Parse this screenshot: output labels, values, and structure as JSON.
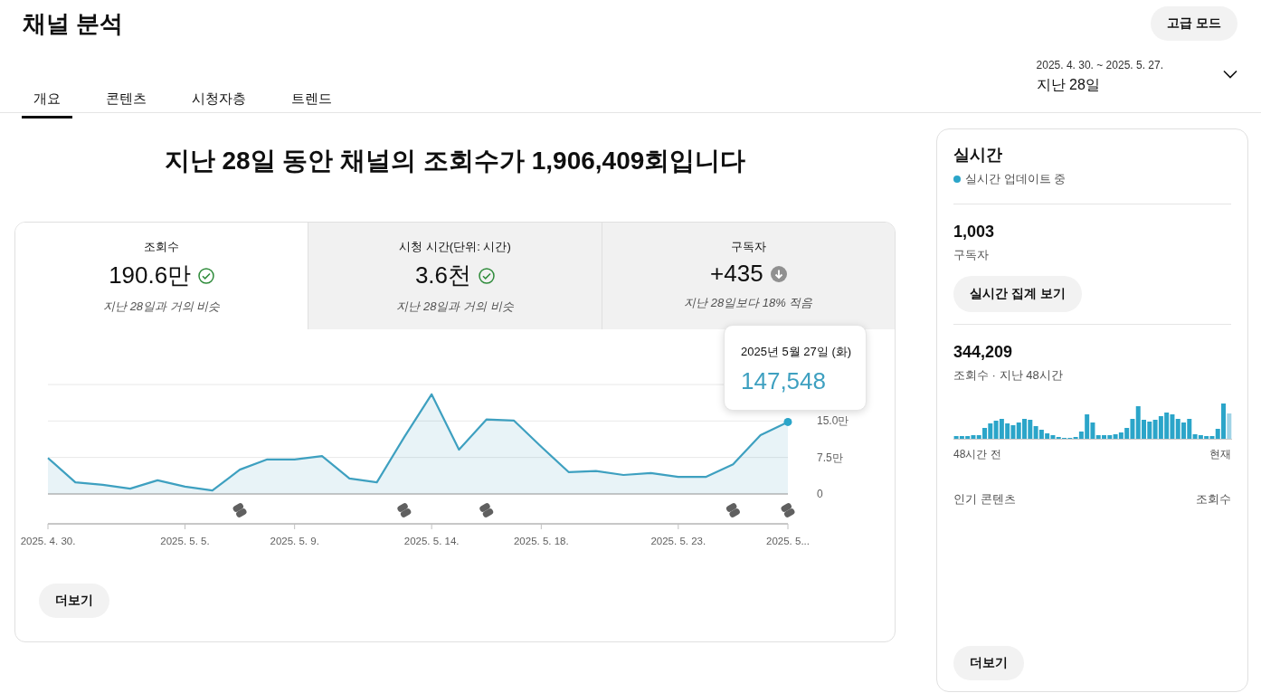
{
  "header": {
    "title": "채널 분석",
    "advanced_button": "고급 모드"
  },
  "tabs": [
    {
      "label": "개요",
      "selected": true
    },
    {
      "label": "콘텐츠",
      "selected": false
    },
    {
      "label": "시청자층",
      "selected": false
    },
    {
      "label": "트렌드",
      "selected": false
    }
  ],
  "date_range": {
    "dates": "2025. 4. 30. ~ 2025. 5. 27.",
    "period": "지난 28일"
  },
  "headline": "지난 28일 동안 채널의 조회수가 1,906,409회입니다",
  "metrics": [
    {
      "label": "조회수",
      "value": "190.6만",
      "kind": "similar",
      "comparison": "지난 28일과 거의 비슷",
      "selected": true
    },
    {
      "label": "시청 시간(단위: 시간)",
      "value": "3.6천",
      "kind": "similar",
      "comparison": "지난 28일과 거의 비슷",
      "selected": false
    },
    {
      "label": "구독자",
      "value": "+435",
      "kind": "down",
      "comparison": "지난 28일보다 18% 적음",
      "selected": false
    }
  ],
  "chart": {
    "tooltip": {
      "date": "2025년 5월 27일 (화)",
      "value": "147,548"
    },
    "chart_data": {
      "type": "area",
      "categories": [
        "2025. 4. 30.",
        null,
        null,
        null,
        null,
        "2025. 5. 5.",
        null,
        null,
        null,
        "2025. 5. 9.",
        null,
        null,
        null,
        null,
        "2025. 5. 14.",
        null,
        null,
        null,
        "2025. 5. 18.",
        null,
        null,
        null,
        null,
        "2025. 5. 23.",
        null,
        null,
        null,
        "2025. 5..."
      ],
      "series": [
        {
          "color": "#3ea0c0",
          "values": [
            7.4,
            2.4,
            1.9,
            1.1,
            2.8,
            1.5,
            0.7,
            5.0,
            7.1,
            7.1,
            7.8,
            3.2,
            2.4,
            11.7,
            20.5,
            9.1,
            15.3,
            15.1,
            9.7,
            4.5,
            4.7,
            3.9,
            4.3,
            3.5,
            3.5,
            6.1,
            12.1,
            14.8
          ]
        }
      ],
      "ylim": [
        0,
        22.5
      ],
      "yticks": [
        {
          "value": 0,
          "label": "0"
        },
        {
          "value": 7.5,
          "label": "7.5만"
        },
        {
          "value": 15,
          "label": "15.0만"
        }
      ]
    }
  },
  "more_button": "더보기",
  "realtime": {
    "title": "실시간",
    "status": "실시간 업데이트 중",
    "subscribers": {
      "value": "1,003",
      "label": "구독자"
    },
    "realtime_button": "실시간 집계 보기",
    "views": {
      "value": "344,209",
      "label": "조회수 · 지난 48시간"
    },
    "range_start": "48시간 전",
    "range_end": "현재",
    "top_content": {
      "label": "인기 콘텐츠",
      "column": "조회수"
    },
    "more_button": "더보기"
  }
}
